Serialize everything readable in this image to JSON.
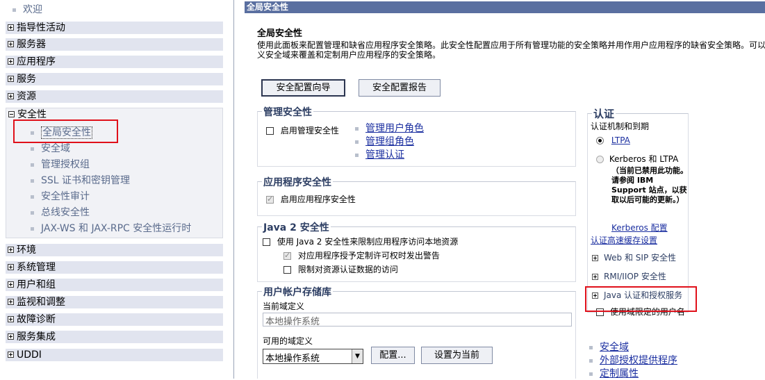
{
  "nav": {
    "welcome": "欢迎",
    "categories_top": [
      {
        "label": "指导性活动"
      },
      {
        "label": "服务器"
      },
      {
        "label": "应用程序"
      },
      {
        "label": "服务"
      },
      {
        "label": "资源"
      }
    ],
    "security": {
      "label": "安全性",
      "items": [
        {
          "label": "全局安全性"
        },
        {
          "label": "安全域"
        },
        {
          "label": "管理授权组"
        },
        {
          "label": "SSL 证书和密钥管理"
        },
        {
          "label": "安全性审计"
        },
        {
          "label": "总线安全性"
        },
        {
          "label": "JAX-WS 和 JAX-RPC 安全性运行时"
        }
      ]
    },
    "categories_bottom": [
      {
        "label": "环境"
      },
      {
        "label": "系统管理"
      },
      {
        "label": "用户和组"
      },
      {
        "label": "监视和调整"
      },
      {
        "label": "故障诊断"
      },
      {
        "label": "服务集成"
      },
      {
        "label": "UDDI"
      }
    ]
  },
  "main": {
    "window_title": "全局安全性",
    "page_title": "全局安全性",
    "description": "使用此面板来配置管理和缺省应用程序安全策略。此安全性配置应用于所有管理功能的安全策略并用作用户应用程序的缺省安全策略。可以义安全域来覆盖和定制用户应用程序的安全策略。",
    "buttons": {
      "wizard": "安全配置向导",
      "report": "安全配置报告"
    },
    "admin_security": {
      "title": "管理安全性",
      "enable_label": "启用管理安全性",
      "enable_checked": false,
      "links": [
        "管理用户角色",
        "管理组角色",
        "管理认证"
      ]
    },
    "app_security": {
      "title": "应用程序安全性",
      "enable_label": "启用应用程序安全性",
      "enable_checked": true
    },
    "java2_security": {
      "title": "Java 2 安全性",
      "use_label": "使用 Java 2 安全性来限制应用程序访问本地资源",
      "warn_label": "对应用程序授予定制许可权时发出警告",
      "restrict_label": "限制对资源认证数据的访问"
    },
    "user_registry": {
      "title": "用户帐户存储库",
      "current_label": "当前域定义",
      "current_value": "本地操作系统",
      "available_label": "可用的域定义",
      "selected": "本地操作系统",
      "configure_button": "配置...",
      "set_current_button": "设置为当前"
    },
    "auth": {
      "title": "认证",
      "mechanism_label": "认证机制和到期",
      "ltpa": "LTPA",
      "kerberos": "Kerberos 和 LTPA",
      "kerberos_note": "（当前已禁用此功能。请参阅 IBM Support 站点，以获取以后可能的更新。）",
      "kerberos_config": "Kerberos 配置",
      "cache_settings": "认证高速缓存设置",
      "web_sip": "Web 和 SIP 安全性",
      "rmi_iiop": "RMI/IIOP 安全性",
      "java_auth": "Java 认证和授权服务",
      "realm_user": "使用域限定的用户名"
    },
    "related": [
      "安全域",
      "外部授权提供程序",
      "定制属性"
    ]
  }
}
